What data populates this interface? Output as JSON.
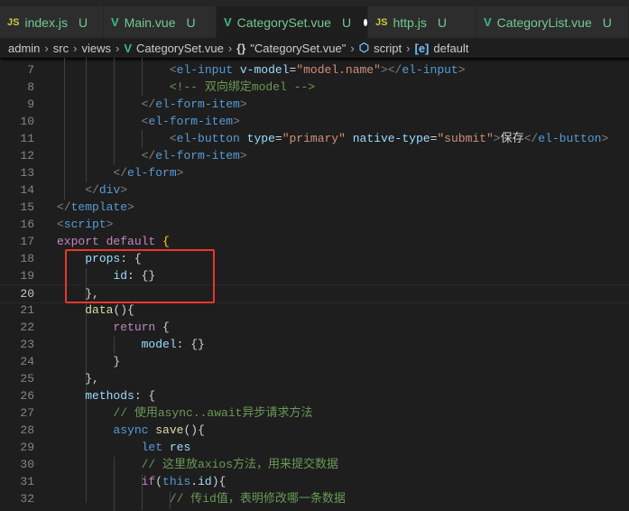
{
  "tabs": [
    {
      "icon": "JS",
      "kind": "js",
      "label": "index.js",
      "status": "U",
      "active": false
    },
    {
      "icon": "V",
      "kind": "vue",
      "label": "Main.vue",
      "status": "U",
      "active": false
    },
    {
      "icon": "V",
      "kind": "vue",
      "label": "CategorySet.vue",
      "status": "U",
      "active": true,
      "dirty": true
    },
    {
      "icon": "JS",
      "kind": "js",
      "label": "http.js",
      "status": "U",
      "active": false
    },
    {
      "icon": "V",
      "kind": "vue",
      "label": "CategoryList.vue",
      "status": "U",
      "active": false
    }
  ],
  "breadcrumb": {
    "items": [
      "admin",
      "src",
      "views",
      "CategorySet.vue",
      "\"CategorySet.vue\"",
      "script",
      "default"
    ],
    "icons": [
      "",
      "",
      "",
      "V",
      "{}",
      "⬡",
      "[e]"
    ]
  },
  "editor": {
    "current_line": 20,
    "lines": [
      {
        "n": 7,
        "code": [
          [
            "w",
            "                "
          ],
          [
            "p",
            "<"
          ],
          [
            "t",
            "el-input"
          ],
          [
            "w",
            " "
          ],
          [
            "a",
            "v-model"
          ],
          [
            "w",
            "="
          ],
          [
            "s",
            "\"model.name\""
          ],
          [
            "p",
            "></"
          ],
          [
            "t",
            "el-input"
          ],
          [
            "p",
            ">"
          ]
        ]
      },
      {
        "n": 8,
        "code": [
          [
            "w",
            "                "
          ],
          [
            "c",
            "<!-- 双向绑定model -->"
          ]
        ]
      },
      {
        "n": 9,
        "code": [
          [
            "w",
            "            "
          ],
          [
            "p",
            "</"
          ],
          [
            "t",
            "el-form-item"
          ],
          [
            "p",
            ">"
          ]
        ]
      },
      {
        "n": 10,
        "code": [
          [
            "w",
            "            "
          ],
          [
            "p",
            "<"
          ],
          [
            "t",
            "el-form-item"
          ],
          [
            "p",
            ">"
          ]
        ]
      },
      {
        "n": 11,
        "code": [
          [
            "w",
            "                "
          ],
          [
            "p",
            "<"
          ],
          [
            "t",
            "el-button"
          ],
          [
            "w",
            " "
          ],
          [
            "a",
            "type"
          ],
          [
            "w",
            "="
          ],
          [
            "s",
            "\"primary\""
          ],
          [
            "w",
            " "
          ],
          [
            "a",
            "native-type"
          ],
          [
            "w",
            "="
          ],
          [
            "s",
            "\"submit\""
          ],
          [
            "p",
            ">"
          ],
          [
            "w",
            "保存"
          ],
          [
            "p",
            "</"
          ],
          [
            "t",
            "el-button"
          ],
          [
            "p",
            ">"
          ]
        ]
      },
      {
        "n": 12,
        "code": [
          [
            "w",
            "            "
          ],
          [
            "p",
            "</"
          ],
          [
            "t",
            "el-form-item"
          ],
          [
            "p",
            ">"
          ]
        ]
      },
      {
        "n": 13,
        "code": [
          [
            "w",
            "        "
          ],
          [
            "p",
            "</"
          ],
          [
            "t",
            "el-form"
          ],
          [
            "p",
            ">"
          ]
        ]
      },
      {
        "n": 14,
        "code": [
          [
            "w",
            "    "
          ],
          [
            "p",
            "</"
          ],
          [
            "t",
            "div"
          ],
          [
            "p",
            ">"
          ]
        ]
      },
      {
        "n": 15,
        "code": [
          [
            "p",
            "</"
          ],
          [
            "t",
            "template"
          ],
          [
            "p",
            ">"
          ]
        ]
      },
      {
        "n": 16,
        "code": [
          [
            "p",
            "<"
          ],
          [
            "t",
            "script"
          ],
          [
            "p",
            ">"
          ]
        ]
      },
      {
        "n": 17,
        "code": [
          [
            "k",
            "export"
          ],
          [
            "w",
            " "
          ],
          [
            "k",
            "default"
          ],
          [
            "w",
            " "
          ],
          [
            "y",
            "{"
          ]
        ]
      },
      {
        "n": 18,
        "code": [
          [
            "w",
            "    "
          ],
          [
            "a",
            "props"
          ],
          [
            "w",
            ": {"
          ]
        ]
      },
      {
        "n": 19,
        "code": [
          [
            "w",
            "        "
          ],
          [
            "a",
            "id"
          ],
          [
            "w",
            ": {}"
          ]
        ]
      },
      {
        "n": 20,
        "code": [
          [
            "w",
            "    },"
          ]
        ]
      },
      {
        "n": 21,
        "code": [
          [
            "w",
            "    "
          ],
          [
            "f",
            "data"
          ],
          [
            "w",
            "(){"
          ]
        ]
      },
      {
        "n": 22,
        "code": [
          [
            "w",
            "        "
          ],
          [
            "k",
            "return"
          ],
          [
            "w",
            " {"
          ]
        ]
      },
      {
        "n": 23,
        "code": [
          [
            "w",
            "            "
          ],
          [
            "a",
            "model"
          ],
          [
            "w",
            ": {}"
          ]
        ]
      },
      {
        "n": 24,
        "code": [
          [
            "w",
            "        }"
          ]
        ]
      },
      {
        "n": 25,
        "code": [
          [
            "w",
            "    },"
          ]
        ]
      },
      {
        "n": 26,
        "code": [
          [
            "w",
            "    "
          ],
          [
            "a",
            "methods"
          ],
          [
            "w",
            ": {"
          ]
        ]
      },
      {
        "n": 27,
        "code": [
          [
            "w",
            "        "
          ],
          [
            "c",
            "// 使用async..await异步请求方法"
          ]
        ]
      },
      {
        "n": 28,
        "code": [
          [
            "w",
            "        "
          ],
          [
            "t",
            "async"
          ],
          [
            "w",
            " "
          ],
          [
            "f",
            "save"
          ],
          [
            "w",
            "(){"
          ]
        ]
      },
      {
        "n": 29,
        "code": [
          [
            "w",
            "            "
          ],
          [
            "t",
            "let"
          ],
          [
            "w",
            " "
          ],
          [
            "a",
            "res"
          ]
        ]
      },
      {
        "n": 30,
        "code": [
          [
            "w",
            "            "
          ],
          [
            "c",
            "// 这里放axios方法，用来提交数据"
          ]
        ]
      },
      {
        "n": 31,
        "code": [
          [
            "w",
            "            "
          ],
          [
            "k",
            "if"
          ],
          [
            "w",
            "("
          ],
          [
            "t",
            "this"
          ],
          [
            "w",
            "."
          ],
          [
            "a",
            "id"
          ],
          [
            "w",
            "){"
          ]
        ]
      },
      {
        "n": 32,
        "code": [
          [
            "w",
            "                "
          ],
          [
            "c",
            "// 传id值，表明修改哪一条数据"
          ]
        ]
      }
    ]
  }
}
